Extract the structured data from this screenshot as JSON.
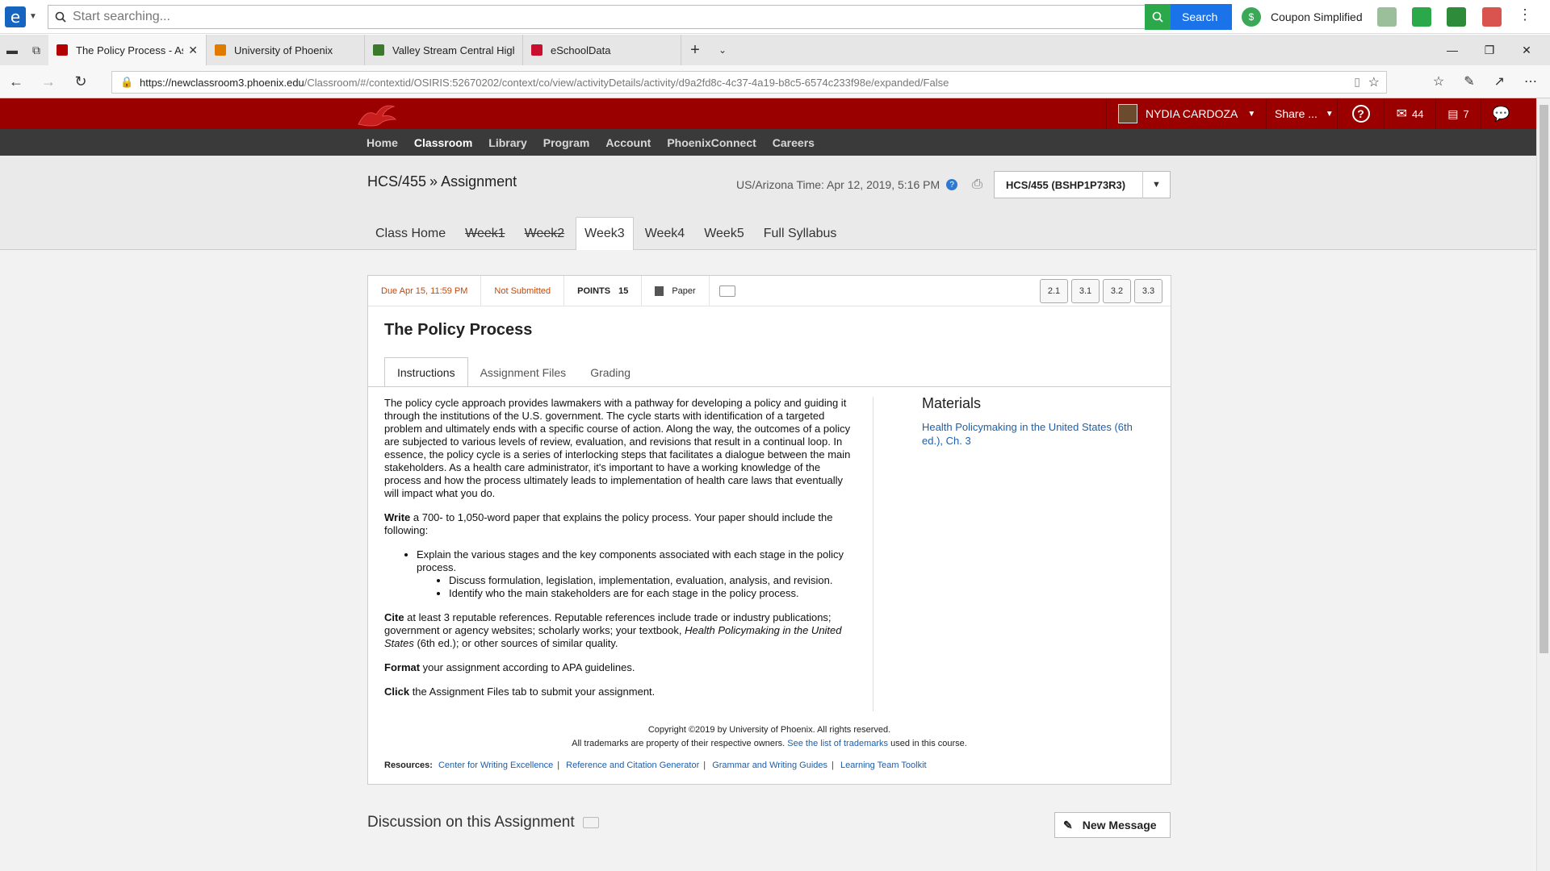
{
  "browser": {
    "search_placeholder": "Start searching...",
    "search_button": "Search",
    "coupon_label": "Coupon Simplified",
    "tabs": [
      {
        "label": "The Policy Process - Ass",
        "color": "#b30000"
      },
      {
        "label": "University of Phoenix",
        "color": "#e07b00"
      },
      {
        "label": "Valley Stream Central High S",
        "color": "#3b7a2b"
      },
      {
        "label": "eSchoolData",
        "color": "#c8102e"
      }
    ],
    "url_host": "https://newclassroom3.phoenix.edu",
    "url_path": "/Classroom/#/contextid/OSIRIS:52670202/context/co/view/activityDetails/activity/d9a2fd8c-4c37-4a19-b8c5-6574c233f98e/expanded/False"
  },
  "topbar": {
    "user_name": "NYDIA CARDOZA",
    "share_label": "Share ...",
    "help": "?",
    "mail_count": "44",
    "inbox_count": "7"
  },
  "nav": [
    "Home",
    "Classroom",
    "Library",
    "Program",
    "Account",
    "PhoenixConnect",
    "Careers"
  ],
  "header": {
    "course": "HCS/455",
    "separator": "»",
    "section": "Assignment",
    "az_time": "US/Arizona Time: Apr 12, 2019, 5:16 PM",
    "course_select": "HCS/455 (BSHP1P73R3)"
  },
  "weeks": [
    {
      "label": "Class Home",
      "state": "normal"
    },
    {
      "label": "Week1",
      "state": "done"
    },
    {
      "label": "Week2",
      "state": "done"
    },
    {
      "label": "Week3",
      "state": "active"
    },
    {
      "label": "Week4",
      "state": "normal"
    },
    {
      "label": "Week5",
      "state": "normal"
    },
    {
      "label": "Full Syllabus",
      "state": "normal"
    }
  ],
  "assignment": {
    "due": "Due Apr 15, 11:59 PM",
    "status": "Not Submitted",
    "points_label": "POINTS",
    "points_value": "15",
    "type": "Paper",
    "versions": [
      "2.1",
      "3.1",
      "3.2",
      "3.3"
    ],
    "title": "The Policy Process",
    "tabs": [
      "Instructions",
      "Assignment Files",
      "Grading"
    ],
    "intro": "The policy cycle approach provides lawmakers with a pathway for developing a policy and guiding it through the institutions of the U.S. government. The cycle starts with identification of a targeted problem and ultimately ends with a specific course of action. Along the way, the outcomes of a policy are subjected to various levels of review, evaluation, and revisions that result in a continual loop. In essence, the policy cycle is a series of interlocking steps that facilitates a dialogue between the main stakeholders. As a health care administrator, it's important to have a working knowledge of the process and how the process ultimately leads to implementation of health care laws that eventually will impact what you do.",
    "write_bold": "Write",
    "write_text": " a 700- to 1,050-word paper that explains the policy process. Your paper should include the following:",
    "bullet1": "Explain the various stages and the key components associated with each stage in the policy process.",
    "sub1": "Discuss formulation, legislation, implementation, evaluation, analysis, and revision.",
    "sub2": "Identify who the main stakeholders are for each stage in the policy process.",
    "cite_bold": "Cite",
    "cite_text": " at least 3 reputable references. Reputable references include trade or industry publications; government or agency websites; scholarly works; your textbook, ",
    "cite_italic": "Health Policymaking in the United States",
    "cite_end": " (6th ed.); or other sources of similar quality.",
    "format_bold": "Format",
    "format_text": " your assignment according to APA guidelines.",
    "click_bold": "Click",
    "click_text": " the Assignment Files tab to submit your assignment.",
    "materials_title": "Materials",
    "materials_link": "Health Policymaking in the United States (6th ed.), Ch. 3",
    "copyright": "Copyright ©2019 by University of Phoenix. All rights reserved.",
    "trademark_a": "All trademarks are property of their respective owners. ",
    "trademark_link": "See the list of trademarks",
    "trademark_b": " used in this course.",
    "resources_label": "Resources:",
    "resources": [
      "Center for Writing Excellence",
      "Reference and Citation Generator",
      "Grammar and Writing Guides",
      "Learning Team Toolkit"
    ]
  },
  "discussion": {
    "title": "Discussion on this Assignment",
    "new_message": "New Message"
  }
}
